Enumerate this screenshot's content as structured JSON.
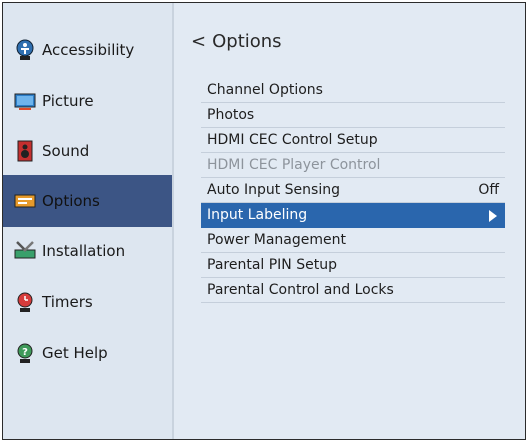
{
  "sidebar": {
    "items": [
      {
        "label": "Accessibility",
        "icon": "accessibility-icon"
      },
      {
        "label": "Picture",
        "icon": "picture-icon"
      },
      {
        "label": "Sound",
        "icon": "sound-icon"
      },
      {
        "label": "Options",
        "icon": "options-icon",
        "selected": true
      },
      {
        "label": "Installation",
        "icon": "installation-icon"
      },
      {
        "label": "Timers",
        "icon": "timers-icon"
      },
      {
        "label": "Get Help",
        "icon": "help-icon"
      }
    ]
  },
  "main": {
    "back_chevron": "<",
    "title": "Options",
    "items": [
      {
        "label": "Channel Options"
      },
      {
        "label": "Photos"
      },
      {
        "label": "HDMI CEC Control Setup"
      },
      {
        "label": "HDMI CEC Player Control",
        "disabled": true
      },
      {
        "label": "Auto Input Sensing",
        "value": "Off"
      },
      {
        "label": "Input Labeling",
        "highlighted": true
      },
      {
        "label": "Power Management"
      },
      {
        "label": "Parental PIN Setup"
      },
      {
        "label": "Parental Control and Locks"
      }
    ]
  },
  "colors": {
    "background": "#e2eaf3",
    "sidebar_selected": "#3c5585",
    "menu_highlight": "#2a66ad"
  }
}
